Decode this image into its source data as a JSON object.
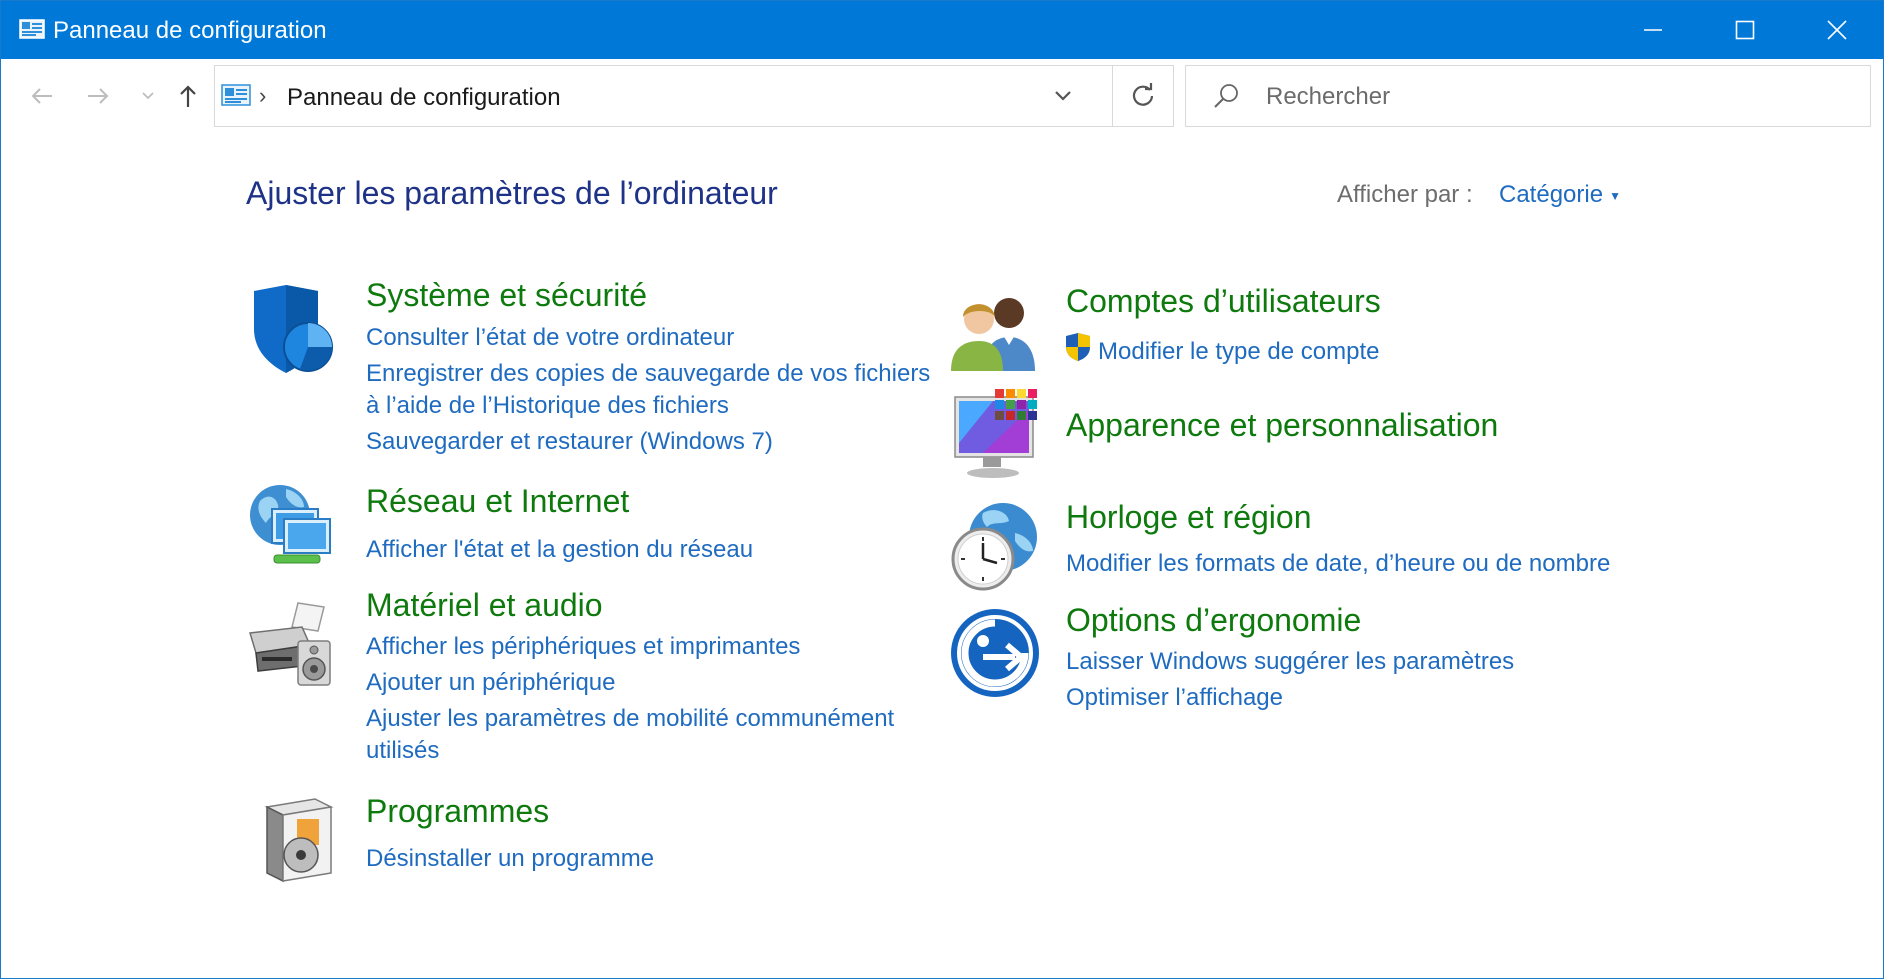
{
  "window": {
    "title": "Panneau de configuration",
    "accent": "#0078d7"
  },
  "nav": {
    "breadcrumb": "Panneau de configuration",
    "search_placeholder": "Rechercher"
  },
  "content": {
    "page_title": "Ajuster les paramètres de l’ordinateur",
    "view_by_label": "Afficher par :",
    "view_by_value": "Catégorie"
  },
  "categories": {
    "system": {
      "title": "Système et sécurité",
      "icon": "shield-icon",
      "links": [
        "Consulter l’état de votre ordinateur",
        "Enregistrer des copies de sauvegarde de vos fichiers",
        "à l’aide de l’Historique des fichiers",
        "Sauvegarder et restaurer (Windows 7)"
      ]
    },
    "network": {
      "title": "Réseau et Internet",
      "icon": "network-globe-icon",
      "links": [
        "Afficher l'état et la gestion du réseau"
      ]
    },
    "hardware": {
      "title": "Matériel et audio",
      "icon": "printer-speaker-icon",
      "links": [
        "Afficher les périphériques et imprimantes",
        "Ajouter un périphérique",
        "Ajuster les paramètres de mobilité communément",
        "utilisés"
      ]
    },
    "programs": {
      "title": "Programmes",
      "icon": "programs-box-icon",
      "links": [
        "Désinstaller un programme"
      ]
    },
    "accounts": {
      "title": "Comptes d’utilisateurs",
      "icon": "users-icon",
      "links": [
        "Modifier le type de compte"
      ]
    },
    "appearance": {
      "title": "Apparence et personnalisation",
      "icon": "monitor-palette-icon",
      "links": []
    },
    "clock": {
      "title": "Horloge et région",
      "icon": "clock-globe-icon",
      "links": [
        "Modifier les formats de date, d’heure ou de nombre"
      ]
    },
    "ease": {
      "title": "Options d’ergonomie",
      "icon": "ease-of-access-icon",
      "links": [
        "Laisser Windows suggérer les paramètres",
        "Optimiser l’affichage"
      ]
    }
  },
  "colors": {
    "title_blue": "#1e3287",
    "link_blue": "#1f6bc0",
    "category_green": "#0e7a0d"
  }
}
